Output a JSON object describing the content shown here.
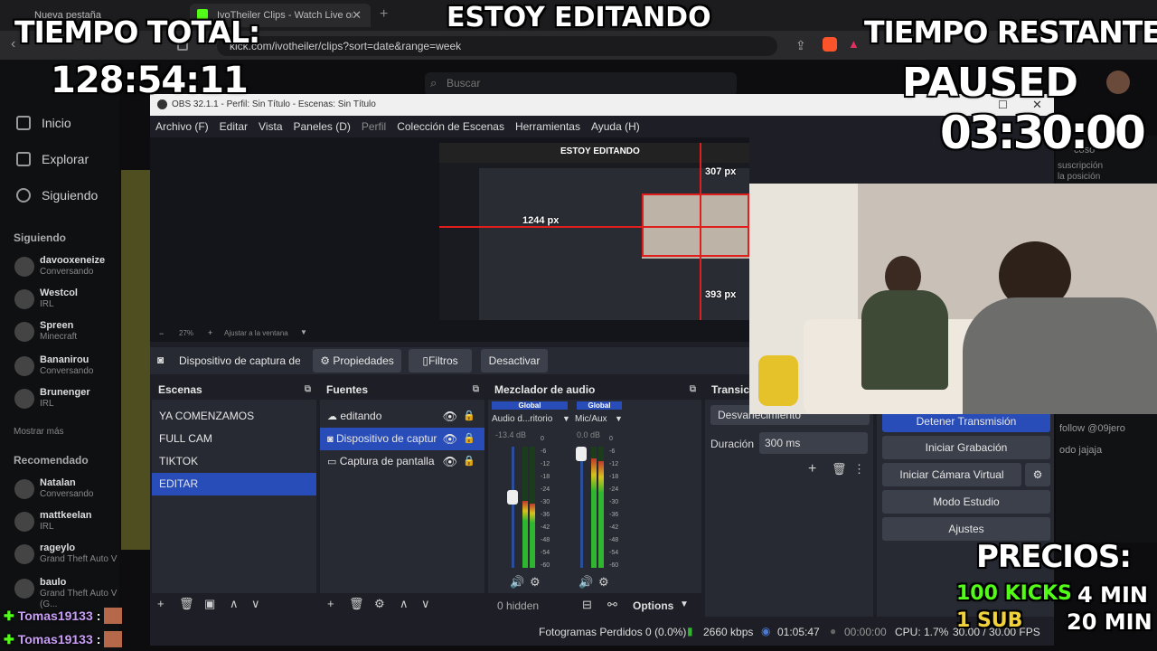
{
  "browser": {
    "tabs": [
      "Nueva pestaña",
      "IvoTheiler Clips - Watch Live on K"
    ],
    "url": "kick.com/ivotheiler/clips?sort=date&range=week",
    "search_placeholder": "Buscar"
  },
  "kick_sidebar": {
    "nav": [
      "Inicio",
      "Explorar",
      "Siguiendo"
    ],
    "following_title": "Siguiendo",
    "following": [
      {
        "name": "davooxeneize",
        "sub": "Conversando"
      },
      {
        "name": "Westcol",
        "sub": "IRL"
      },
      {
        "name": "Spreen",
        "sub": "Minecraft"
      },
      {
        "name": "Bananirou",
        "sub": "Conversando"
      },
      {
        "name": "Brunenger",
        "sub": "IRL"
      }
    ],
    "show_more": "Mostrar más",
    "recommended_title": "Recomendado",
    "recommended": [
      {
        "name": "Natalan",
        "sub": "Conversando"
      },
      {
        "name": "mattkeelan",
        "sub": "IRL"
      },
      {
        "name": "rageylo",
        "sub": "Grand Theft Auto V"
      },
      {
        "name": "baulo",
        "sub": "Grand Theft Auto V (G..."
      }
    ]
  },
  "overlay": {
    "top_title": "ESTOY EDITANDO",
    "total_label": "TIEMPO TOTAL:",
    "total_value": "128:54:11",
    "remaining_label": "TIEMPO RESTANTE:",
    "paused": "PAUSED",
    "remaining_value": "03:30:00",
    "prices_label": "PRECIOS:",
    "prices": [
      {
        "item": "100 KICKS",
        "value": "4 MIN"
      },
      {
        "item": "1 SUB",
        "value": "20 MIN"
      }
    ],
    "chat": [
      {
        "user": "Tomas19133",
        "sep": ":"
      },
      {
        "user": "Tomas19133",
        "sep": ":"
      }
    ],
    "chat_right_snippets": [
      "coso",
      "suscripción",
      "la posición",
      "follow @09jero",
      "odo jajaja"
    ]
  },
  "obs": {
    "title": "OBS 32.1.1 - Perfil: Sin Título - Escenas: Sin Título",
    "menu": [
      "Archivo (F)",
      "Editar",
      "Vista",
      "Paneles (D)",
      "Perfil",
      "Colección de Escenas",
      "Herramientas",
      "Ayuda (H)"
    ],
    "preview": {
      "zoom": "27%",
      "fit": "Ajustar a la ventana",
      "inner_title": "ESTOY EDITANDO",
      "measure_top": "307 px",
      "measure_left": "1244 px",
      "measure_bottom": "393 px"
    },
    "source_toolbar": {
      "source_name": "Dispositivo de captura de v",
      "properties": "Propiedades",
      "filters": "Filtros",
      "deactivate": "Desactivar"
    },
    "scenes": {
      "title": "Escenas",
      "items": [
        "YA COMENZAMOS",
        "FULL CAM",
        "TIKTOK",
        "EDITAR"
      ],
      "selected": "EDITAR"
    },
    "sources": {
      "title": "Fuentes",
      "items": [
        "editando",
        "Dispositivo de captur",
        "Captura de pantalla"
      ],
      "selected": "Dispositivo de captur"
    },
    "mixer": {
      "title": "Mezclador de audio",
      "channels": [
        {
          "tag": "Global",
          "name": "Audio d...ritorio",
          "db": "-13.4 dB",
          "level": 0.55
        },
        {
          "tag": "Global",
          "name": "Mic/Aux",
          "db": "0.0 dB",
          "level": 0.9
        }
      ],
      "scale": [
        "0",
        "-6",
        "-12",
        "-18",
        "-24",
        "-30",
        "-36",
        "-42",
        "-48",
        "-54",
        "-60"
      ],
      "hidden": "0 hidden",
      "options": "Options"
    },
    "transitions": {
      "title": "Transici",
      "selected": "Desvanecimiento",
      "duration_label": "Duración",
      "duration_value": "300 ms"
    },
    "controls": {
      "stop_stream": "Detener Transmisión",
      "start_recording": "Iniciar Grabación",
      "virtual_camera": "Iniciar Cámara Virtual",
      "studio_mode": "Modo Estudio",
      "settings": "Ajustes"
    },
    "status": {
      "dropped": "Fotogramas Perdidos 0 (0.0%)",
      "bitrate": "2660 kbps",
      "stream_time": "01:05:47",
      "rec_time": "00:00:00",
      "cpu": "CPU: 1.7%",
      "fps": "30.00 / 30.00 FPS"
    }
  },
  "colors": {
    "accent_blue": "#284cb8",
    "kick_green": "#53fc18",
    "meter_green": "#2fb52f",
    "meter_red": "#c0392b"
  }
}
